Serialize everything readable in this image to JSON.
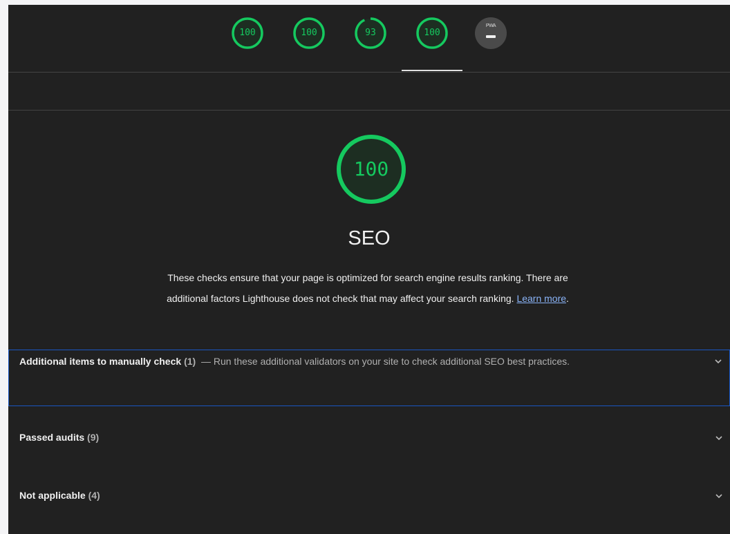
{
  "top_scores": [
    {
      "value": "100"
    },
    {
      "value": "100"
    },
    {
      "value": "93"
    },
    {
      "value": "100"
    }
  ],
  "pwa": {
    "label": "PWA",
    "value": "–"
  },
  "colors": {
    "pass": "#15c95f",
    "background": "#212121",
    "link": "#8ab4f8",
    "focus": "#1a57c4"
  },
  "category": {
    "score": "100",
    "title": "SEO",
    "description": "These checks ensure that your page is optimized for search engine results ranking. There are additional factors Lighthouse does not check that may affect your search ranking.",
    "learn_more": "Learn more",
    "period": "."
  },
  "groups": [
    {
      "title": "Additional items to manually check",
      "count": "(1)",
      "separator": "—",
      "description": "Run these additional validators on your site to check additional SEO best practices.",
      "icon": "chevron-down-icon"
    },
    {
      "title": "Passed audits",
      "count": "(9)",
      "icon": "chevron-down-icon"
    },
    {
      "title": "Not applicable",
      "count": "(4)",
      "icon": "chevron-down-icon"
    }
  ]
}
